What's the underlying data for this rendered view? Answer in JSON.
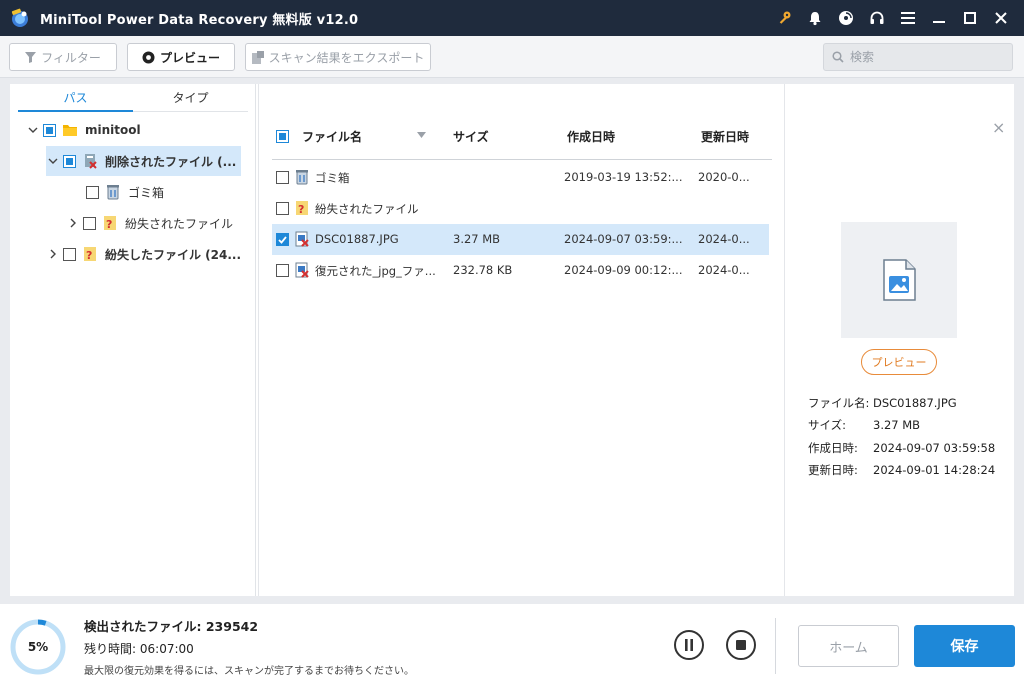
{
  "window": {
    "title": "MiniTool Power Data Recovery 無料版 v12.0",
    "buttons": [
      "key-icon",
      "bell-icon",
      "disc-icon",
      "headset-icon",
      "menu-icon",
      "minimize-icon",
      "maximize-icon",
      "close-icon"
    ]
  },
  "toolbar": {
    "filter_label": "フィルター",
    "preview_label": "プレビュー",
    "export_label": "スキャン結果をエクスポート",
    "search_placeholder": "検索"
  },
  "left": {
    "tabs": [
      {
        "label": "パス",
        "active": true
      },
      {
        "label": "タイプ",
        "active": false
      }
    ],
    "tree": [
      {
        "label": "minitool",
        "level": 0,
        "expanded": true,
        "checked": "partial",
        "icon": "folder-icon"
      },
      {
        "label": "削除されたファイル (...",
        "level": 1,
        "expanded": true,
        "checked": "partial",
        "icon": "deleted-files-icon",
        "selected": true
      },
      {
        "label": "ゴミ箱",
        "level": 2,
        "checked": "none",
        "icon": "recycle-bin-icon"
      },
      {
        "label": "紛失されたファイル",
        "level": 2,
        "expanded": false,
        "checked": "none",
        "icon": "lost-files-icon"
      },
      {
        "label": "紛失したファイル (24...",
        "level": 1,
        "expanded": false,
        "checked": "none",
        "icon": "lost-files-icon"
      }
    ]
  },
  "files": {
    "columns": {
      "name": "ファイル名",
      "size": "サイズ",
      "created": "作成日時",
      "modified": "更新日時"
    },
    "rows": [
      {
        "name": "ゴミ箱",
        "size": "",
        "created": "2019-03-19 13:52:...",
        "modified": "2020-0...",
        "checked": false,
        "icon": "recycle-bin-icon"
      },
      {
        "name": "紛失されたファイル",
        "size": "",
        "created": "",
        "modified": "",
        "checked": false,
        "icon": "lost-files-icon"
      },
      {
        "name": "DSC01887.JPG",
        "size": "3.27 MB",
        "created": "2024-09-07 03:59:...",
        "modified": "2024-0...",
        "checked": true,
        "selected": true,
        "icon": "deleted-image-icon"
      },
      {
        "name": "復元された_jpg_ファ...",
        "size": "232.78 KB",
        "created": "2024-09-09 00:12:...",
        "modified": "2024-0...",
        "checked": false,
        "icon": "deleted-image-icon"
      }
    ]
  },
  "preview": {
    "button_label": "プレビュー",
    "fields": [
      {
        "label": "ファイル名:",
        "value": "DSC01887.JPG"
      },
      {
        "label": "サイズ:",
        "value": "3.27 MB"
      },
      {
        "label": "作成日時:",
        "value": "2024-09-07 03:59:58"
      },
      {
        "label": "更新日時:",
        "value": "2024-09-01 14:28:24"
      }
    ]
  },
  "status": {
    "progress_percent": 5,
    "progress_label": "5%",
    "found_label": "検出されたファイル:",
    "found_count": "239542",
    "remaining_label": "残り時間:",
    "remaining_time": "06:07:00",
    "hint": "最大限の復元効果を得るには、スキャンが完了するまでお待ちください。"
  },
  "actions": {
    "home_label": "ホーム",
    "save_label": "保存"
  },
  "colors": {
    "accent": "#1e88d8",
    "titlebar": "#1f2b3d",
    "selection": "#d4e8fa",
    "preview_button": "#e07b22",
    "key_icon": "#f0a830"
  }
}
